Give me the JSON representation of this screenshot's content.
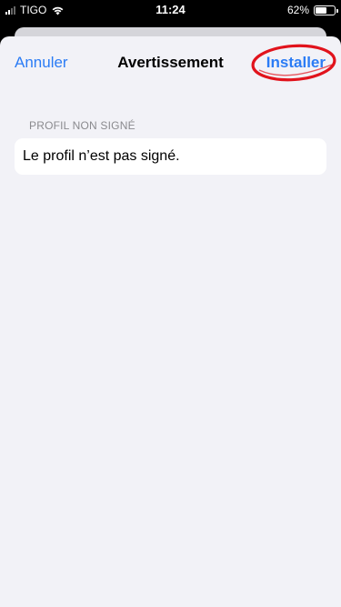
{
  "status_bar": {
    "carrier": "TIGO",
    "time": "11:24",
    "battery_percent": "62%",
    "battery_level": 0.62,
    "signal_bars": 2,
    "text_color": "#ffffff"
  },
  "nav": {
    "cancel_label": "Annuler",
    "title": "Avertissement",
    "install_label": "Installer",
    "tint_color": "#2b7cf5"
  },
  "annotation": {
    "type": "ellipse",
    "color": "#e1131c",
    "target": "install-button"
  },
  "section": {
    "header": "PROFIL NON SIGNÉ",
    "rows": [
      {
        "text": "Le profil n’est pas signé."
      }
    ]
  },
  "colors": {
    "sheet_background": "#f2f2f7",
    "cell_background": "#ffffff",
    "section_header": "#8a8a8e"
  },
  "icons": [
    "signal-icon",
    "wifi-icon",
    "battery-icon"
  ]
}
